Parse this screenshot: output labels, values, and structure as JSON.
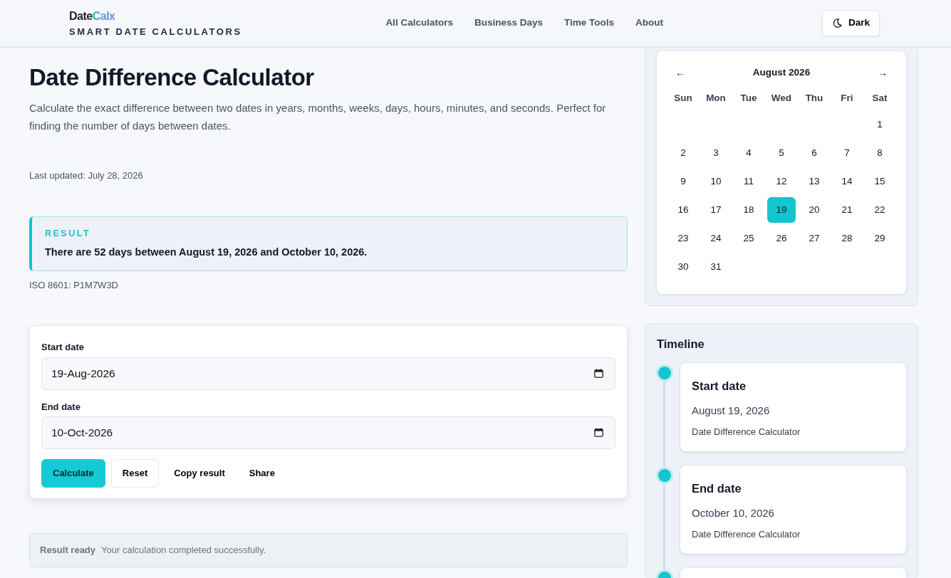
{
  "header": {
    "brand_main": "Date",
    "brand_accent": "Calx",
    "tagline": "SMART DATE CALCULATORS",
    "nav": [
      {
        "label": "All Calculators"
      },
      {
        "label": "Business Days"
      },
      {
        "label": "Time Tools"
      },
      {
        "label": "About"
      }
    ],
    "theme_button": "Dark"
  },
  "page": {
    "title": "Date Difference Calculator",
    "description": "Calculate the exact difference between two dates in years, months, weeks, days, hours, minutes, and seconds. Perfect for finding the number of days between dates.",
    "last_updated": "Last updated: July 28, 2026"
  },
  "result": {
    "label": "RESULT",
    "text": "There are 52 days between August 19, 2026 and October 10, 2026.",
    "iso": "ISO 8601: P1M7W3D"
  },
  "form": {
    "fields": [
      {
        "label": "Start date",
        "value": "19-Aug-2026"
      },
      {
        "label": "End date",
        "value": "10-Oct-2026"
      }
    ],
    "buttons": [
      {
        "label": "Calculate",
        "kind": "primary"
      },
      {
        "label": "Reset",
        "kind": "outline"
      },
      {
        "label": "Copy result",
        "kind": "plain"
      },
      {
        "label": "Share",
        "kind": "plain"
      }
    ]
  },
  "status": {
    "title": "Result ready",
    "message": "Your calculation completed successfully."
  },
  "calendar": {
    "prev": "←",
    "month": "August 2026",
    "next": "→",
    "weekdays": [
      "Sun",
      "Mon",
      "Tue",
      "Wed",
      "Thu",
      "Fri",
      "Sat"
    ],
    "weeks": [
      [
        {
          "label": "1",
          "selected": false
        }
      ],
      [
        {
          "label": "2",
          "selected": false
        },
        {
          "label": "3",
          "selected": false
        },
        {
          "label": "4",
          "selected": false
        },
        {
          "label": "5",
          "selected": false
        },
        {
          "label": "6",
          "selected": false
        },
        {
          "label": "7",
          "selected": false
        },
        {
          "label": "8",
          "selected": false
        }
      ],
      [
        {
          "label": "9",
          "selected": false
        },
        {
          "label": "10",
          "selected": false
        },
        {
          "label": "11",
          "selected": false
        },
        {
          "label": "12",
          "selected": false
        },
        {
          "label": "13",
          "selected": false
        },
        {
          "label": "14",
          "selected": false
        },
        {
          "label": "15",
          "selected": false
        }
      ],
      [
        {
          "label": "16",
          "selected": false
        },
        {
          "label": "17",
          "selected": false
        },
        {
          "label": "18",
          "selected": false
        },
        {
          "label": "19",
          "selected": true
        },
        {
          "label": "20",
          "selected": false
        },
        {
          "label": "21",
          "selected": false
        },
        {
          "label": "22",
          "selected": false
        }
      ],
      [
        {
          "label": "23",
          "selected": false
        },
        {
          "label": "24",
          "selected": false
        },
        {
          "label": "25",
          "selected": false
        },
        {
          "label": "26",
          "selected": false
        },
        {
          "label": "27",
          "selected": false
        },
        {
          "label": "28",
          "selected": false
        },
        {
          "label": "29",
          "selected": false
        }
      ],
      [
        {
          "label": "30",
          "selected": false
        },
        {
          "label": "31",
          "selected": false
        }
      ]
    ]
  },
  "timeline": {
    "title": "Timeline",
    "items": [
      {
        "kind": "event",
        "title": "Start date",
        "date": "August 19, 2026",
        "source": "Date Difference Calculator"
      },
      {
        "kind": "event",
        "title": "End date",
        "date": "October 10, 2026",
        "source": "Date Difference Calculator"
      },
      {
        "kind": "partial"
      }
    ]
  }
}
